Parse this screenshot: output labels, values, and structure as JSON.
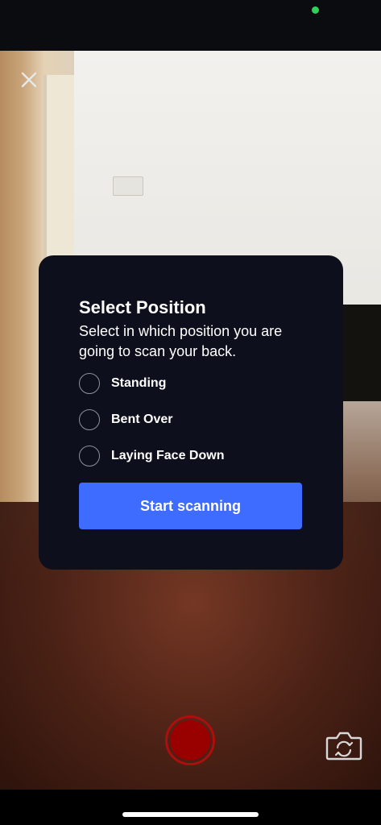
{
  "modal": {
    "title": "Select Position",
    "description": "Select in which position you are going to scan your back.",
    "options": [
      {
        "label": "Standing",
        "selected": false
      },
      {
        "label": "Bent Over",
        "selected": false
      },
      {
        "label": "Laying Face Down",
        "selected": false
      }
    ],
    "start_button_label": "Start scanning"
  },
  "icons": {
    "close": "close-icon",
    "record": "record-icon",
    "flip_camera": "flip-camera-icon"
  },
  "colors": {
    "modal_background": "#0d0f1c",
    "primary_button": "#3d6cff",
    "record": "#990000",
    "privacy_indicator": "#2fd158"
  }
}
